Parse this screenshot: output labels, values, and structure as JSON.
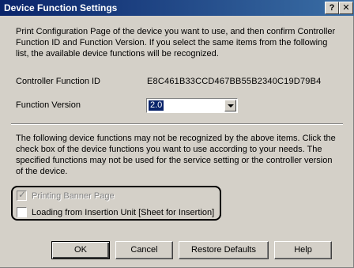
{
  "window": {
    "title": "Device Function Settings",
    "help_glyph": "?",
    "close_glyph": "✕"
  },
  "intro_text": "Print Configuration Page of the device you want to use, and then confirm Controller Function ID and Function Version. If you select the same items from the following list, the available device functions will be recognized.",
  "controller_function_id": {
    "label": "Controller Function ID",
    "value": "E8C461B33CCD467BB55B2340C19D79B4"
  },
  "function_version": {
    "label": "Function Version",
    "selected": "2.0"
  },
  "note_text": "The following device functions may not be recognized by the above items. Click the check box of the device functions you want to use according to your needs. The specified functions may not be used for the service setting or the controller version of the device.",
  "functions": [
    {
      "label": "Printing Banner Page",
      "checked": true,
      "enabled": false
    },
    {
      "label": "Loading from Insertion Unit [Sheet for Insertion]",
      "checked": false,
      "enabled": true
    }
  ],
  "buttons": {
    "ok": "OK",
    "cancel": "Cancel",
    "restore_defaults": "Restore Defaults",
    "help": "Help"
  },
  "colors": {
    "titlebar": "#0a246a",
    "dialog_face": "#d4d0c8",
    "highlight_border": "#000000"
  }
}
